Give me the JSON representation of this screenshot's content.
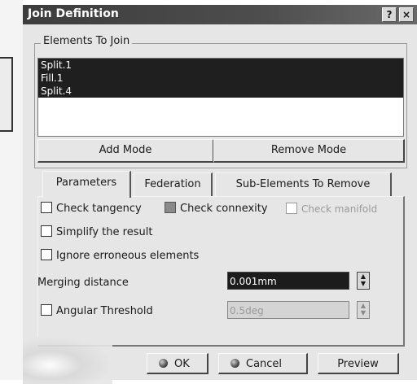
{
  "window": {
    "title": "Join Definition",
    "help_label": "?",
    "close_label": "×"
  },
  "elements_group": {
    "label": "Elements To Join",
    "items": [
      "Split.1",
      "Fill.1",
      "Split.4"
    ]
  },
  "modes": {
    "add_label": "Add Mode",
    "remove_label": "Remove Mode"
  },
  "tabs": [
    {
      "label": "Parameters",
      "active": true
    },
    {
      "label": "Federation",
      "active": false
    },
    {
      "label": "Sub-Elements To Remove",
      "active": false
    }
  ],
  "parameters": {
    "check_tangency": {
      "label": "Check tangency",
      "checked": false
    },
    "check_connexity": {
      "label": "Check connexity",
      "checked": true,
      "enabled": false
    },
    "check_manifold": {
      "label": "Check manifold",
      "checked": false,
      "enabled": false
    },
    "simplify": {
      "label": "Simplify the result",
      "checked": false
    },
    "ignore_erroneous": {
      "label": "Ignore erroneous elements",
      "checked": false
    },
    "merging_distance": {
      "label": "Merging distance",
      "value": "0.001mm"
    },
    "angular_threshold": {
      "label": "Angular Threshold",
      "checked": false,
      "value": "0.5deg",
      "enabled": false
    }
  },
  "buttons": {
    "ok_label": "OK",
    "cancel_label": "Cancel",
    "preview_label": "Preview"
  },
  "icons": {
    "spin_up": "spin-up-icon",
    "spin_down": "spin-down-icon",
    "ok_icon": "ok-dot-icon",
    "cancel_icon": "cancel-dot-icon"
  }
}
